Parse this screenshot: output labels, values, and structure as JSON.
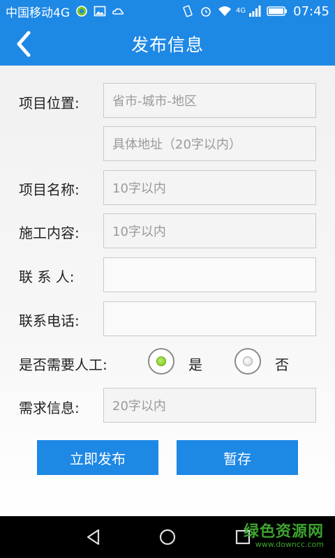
{
  "status_bar": {
    "carrier": "中国移动4G",
    "network_tag": "4G",
    "time": "07:45"
  },
  "title_bar": {
    "title": "发布信息"
  },
  "form": {
    "location_label": "项目位置:",
    "location_placeholder": "省市-城市-地区",
    "address_placeholder": "具体地址（20字以内）",
    "name_label": "项目名称:",
    "name_placeholder": "10字以内",
    "work_label": "施工内容:",
    "work_placeholder": "10字以内",
    "contact_label": "联 系 人:",
    "contact_value": "",
    "phone_label": "联系电话:",
    "phone_value": "",
    "labor_label": "是否需要人工:",
    "labor_yes": "是",
    "labor_no": "否",
    "labor_selected": "是",
    "demand_label": "需求信息:",
    "demand_placeholder": "20字以内"
  },
  "buttons": {
    "publish": "立即发布",
    "save_draft": "暂存"
  },
  "watermark": {
    "main": "绿色资源网",
    "url": "www.downcc.com"
  },
  "colors": {
    "primary": "#1e88e5",
    "radio_selected": "#7cc21a",
    "watermark": "#3da32e"
  }
}
